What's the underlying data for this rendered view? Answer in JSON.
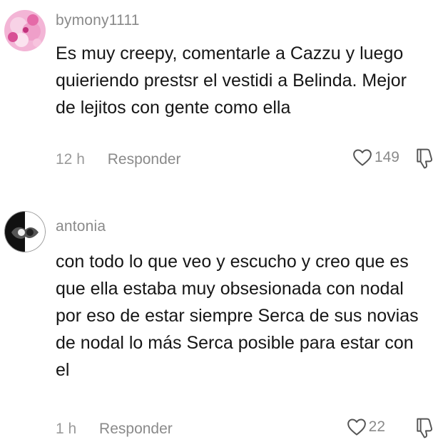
{
  "comments": [
    {
      "username": "bymony1111",
      "text": "Es muy creepy, comentarle a Cazzu y luego\nquieriendo prestsr el vestidi a Belinda. Mejor\nde lejitos con gente como ella",
      "time": "12 h",
      "reply_label": "Responder",
      "likes": "149"
    },
    {
      "username": "antonia",
      "text": "con todo lo que veo y escucho y creo que es\nque ella estaba muy obsesionada con nodal\npor eso de estar siempre Serca de sus novias\nde nodal lo más Serca posible para estar con\nel",
      "time": "1 h",
      "reply_label": "Responder",
      "likes": "22"
    }
  ],
  "colors": {
    "meta": "#9a9a9a",
    "text": "#161616",
    "avatar1": "#e06aa8"
  },
  "icons": {
    "like": "heart-outline-icon",
    "dislike": "thumbs-down-icon"
  }
}
